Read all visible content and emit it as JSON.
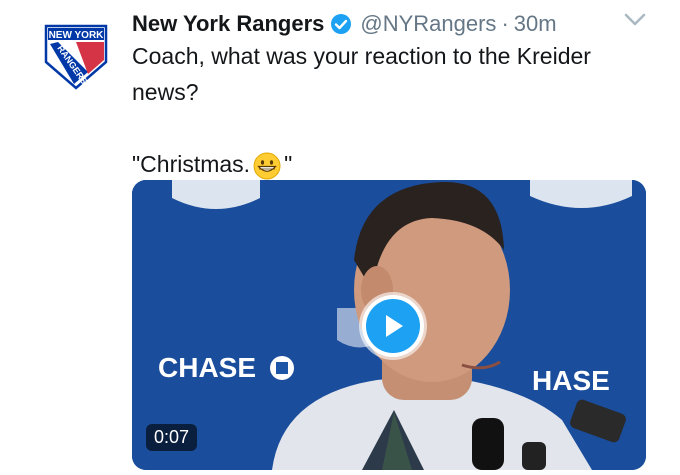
{
  "tweet": {
    "author_name": "New York Rangers",
    "handle": "@NYRangers",
    "separator": "·",
    "time": "30m",
    "text_line1": "Coach, what was your reaction to the Kreider",
    "text_line2": "news?",
    "quote_open": "\"Christmas.",
    "quote_close": "\""
  },
  "avatar": {
    "logo_top": "NEW YORK",
    "logo_diag": "RANGERS"
  },
  "media": {
    "duration": "0:07",
    "sponsor_left": "CHASE",
    "sponsor_right": "HASE"
  },
  "icons": {
    "verified": "verified-badge-icon",
    "menu": "chevron-down-icon",
    "play": "play-icon",
    "emoji": "grinning-face-icon"
  },
  "colors": {
    "accent": "#1da1f2",
    "rangers_blue": "#0038a8",
    "rangers_red": "#ce1126"
  }
}
